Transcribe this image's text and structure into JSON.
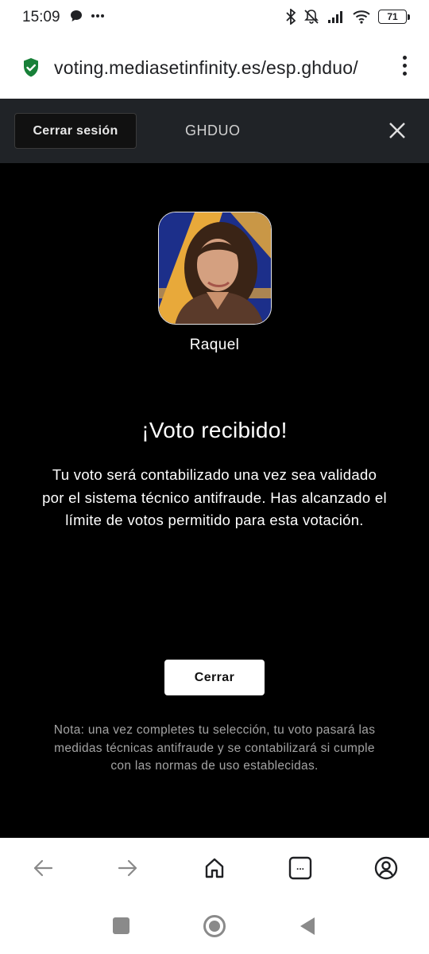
{
  "status_bar": {
    "time": "15:09",
    "battery": "71"
  },
  "browser": {
    "url": "voting.mediasetinfinity.es/esp.ghduo/",
    "icons": [
      "shield-check-icon",
      "more-vert-icon"
    ]
  },
  "header": {
    "logout_label": "Cerrar sesión",
    "title": "GHDUO"
  },
  "candidate": {
    "name": "Raquel"
  },
  "confirmation": {
    "title": "¡Voto recibido!",
    "message": "Tu voto será contabilizado una vez sea validado por el sistema técnico antifraude. Has alcanzado el límite de votos permitido para esta votación.",
    "close_label": "Cerrar",
    "note": "Nota: una vez completes tu selección, tu voto pasará las medidas técnicas antifraude y se contabilizará si cumple con las normas de uso establecidas."
  },
  "bottom_nav": {
    "tabs_label": "..."
  },
  "colors": {
    "background": "#000000",
    "header_bg": "#202327",
    "shield_green": "#188038",
    "avatar_blue": "#1c2f8a",
    "avatar_gold": "#e8a93a"
  }
}
